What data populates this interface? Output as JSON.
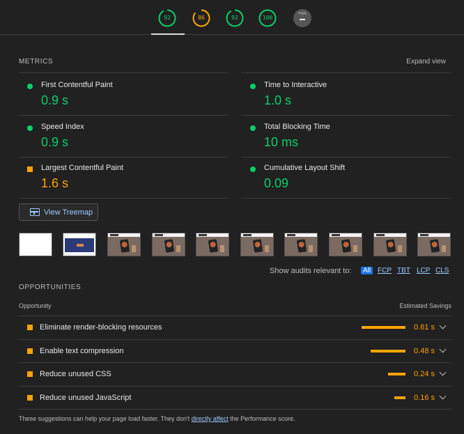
{
  "gauges": [
    {
      "name": "performance",
      "score": 92,
      "fraction": 0.92,
      "color": "#0cce6b",
      "active": true
    },
    {
      "name": "accessibility",
      "score": 86,
      "fraction": 0.86,
      "color": "#ffa400",
      "active": false
    },
    {
      "name": "best-practices",
      "score": 92,
      "fraction": 0.92,
      "color": "#0cce6b",
      "active": false
    },
    {
      "name": "seo",
      "score": 100,
      "fraction": 1.0,
      "color": "#0cce6b",
      "active": false
    }
  ],
  "pwa": {
    "label": "PWA",
    "value": "–"
  },
  "metrics_section": {
    "title": "METRICS",
    "expand_label": "Expand view"
  },
  "metrics": [
    {
      "label": "First Contentful Paint",
      "value": "0.9 s",
      "status": "pass"
    },
    {
      "label": "Time to Interactive",
      "value": "1.0 s",
      "status": "pass"
    },
    {
      "label": "Speed Index",
      "value": "0.9 s",
      "status": "pass"
    },
    {
      "label": "Total Blocking Time",
      "value": "10 ms",
      "status": "pass"
    },
    {
      "label": "Largest Contentful Paint",
      "value": "1.6 s",
      "status": "average"
    },
    {
      "label": "Cumulative Layout Shift",
      "value": "0.09",
      "status": "pass"
    }
  ],
  "treemap": {
    "label": "View Treemap"
  },
  "filmstrip": [
    "blank",
    "hero",
    "site",
    "site",
    "site",
    "site",
    "site",
    "site",
    "site",
    "site"
  ],
  "filters": {
    "label": "Show audits relevant to:",
    "options": [
      "All",
      "FCP",
      "TBT",
      "LCP",
      "CLS"
    ],
    "selected": "All"
  },
  "opportunities": {
    "title": "OPPORTUNITIES",
    "col_opportunity": "Opportunity",
    "col_savings": "Estimated Savings",
    "items": [
      {
        "label": "Eliminate render-blocking resources",
        "savings": "0.61 s",
        "fraction": 1.0
      },
      {
        "label": "Enable text compression",
        "savings": "0.48 s",
        "fraction": 0.79
      },
      {
        "label": "Reduce unused CSS",
        "savings": "0.24 s",
        "fraction": 0.39
      },
      {
        "label": "Reduce unused JavaScript",
        "savings": "0.16 s",
        "fraction": 0.26
      }
    ]
  },
  "footer": {
    "text_before": "These suggestions can help your page load faster. They don't ",
    "link": "directly affect",
    "text_after": " the Performance score."
  },
  "colors": {
    "pass": "#0cce6b",
    "average": "#ffa400",
    "link": "#9ecbff",
    "background": "#212121"
  }
}
